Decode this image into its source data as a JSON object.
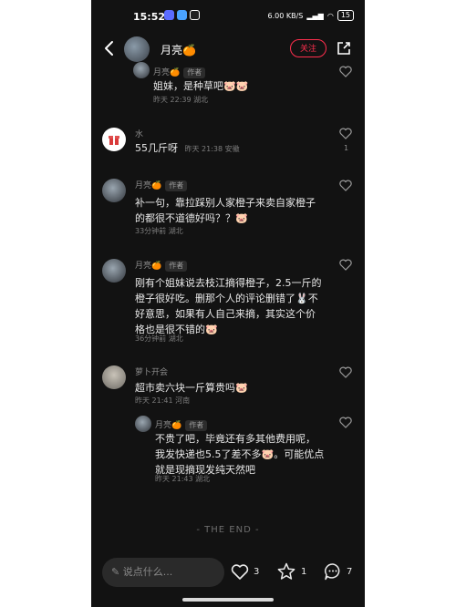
{
  "status_bar": {
    "time": "15:52",
    "network_speed": "6.00 KB/S",
    "battery": "15"
  },
  "header": {
    "author_name": "月亮🍊",
    "follow_label": "关注"
  },
  "comments": [
    {
      "username": "月亮🍊",
      "author_badge": "作者",
      "text": "姐妹，是种草吧🐷🐷",
      "meta": "昨天 22:39 湖北",
      "likes": ""
    },
    {
      "username": "水",
      "author_badge": "",
      "text": "55几斤呀",
      "meta": "昨天 21:38 安徽",
      "likes": "1"
    },
    {
      "username": "月亮🍊",
      "author_badge": "作者",
      "text": "补一句，靠拉踩别人家橙子来卖自家橙子的都很不道德好吗？？🐷",
      "meta": "33分钟前 湖北",
      "likes": ""
    },
    {
      "username": "月亮🍊",
      "author_badge": "作者",
      "text": "刚有个姐妹说去枝江摘得橙子，2.5一斤的橙子很好吃。删那个人的评论删错了🐰不好意思，如果有人自己来摘，其实这个价格也是很不错的🐷",
      "meta": "36分钟前 湖北",
      "likes": ""
    },
    {
      "username": "萝卜开会",
      "author_badge": "",
      "text": "超市卖六块一斤算贵吗🐷",
      "meta": "昨天 21:41 河南",
      "likes": ""
    },
    {
      "username": "月亮🍊",
      "author_badge": "作者",
      "text": "不贵了吧，毕竟还有多其他费用呢，我发快递也5.5了差不多🐷。可能优点就是现摘现发纯天然吧",
      "meta": "昨天 21:43 湖北",
      "likes": ""
    }
  ],
  "end_text": "- THE END -",
  "bottom_bar": {
    "comment_placeholder": "说点什么...",
    "like_count": "3",
    "star_count": "1",
    "comment_count": "7"
  },
  "colors": {
    "background": "#121212",
    "accent": "#ff2e4d"
  },
  "icons": [
    "back-arrow-icon",
    "share-icon",
    "heart-icon",
    "star-icon",
    "comment-bubble-icon",
    "pencil-icon"
  ]
}
